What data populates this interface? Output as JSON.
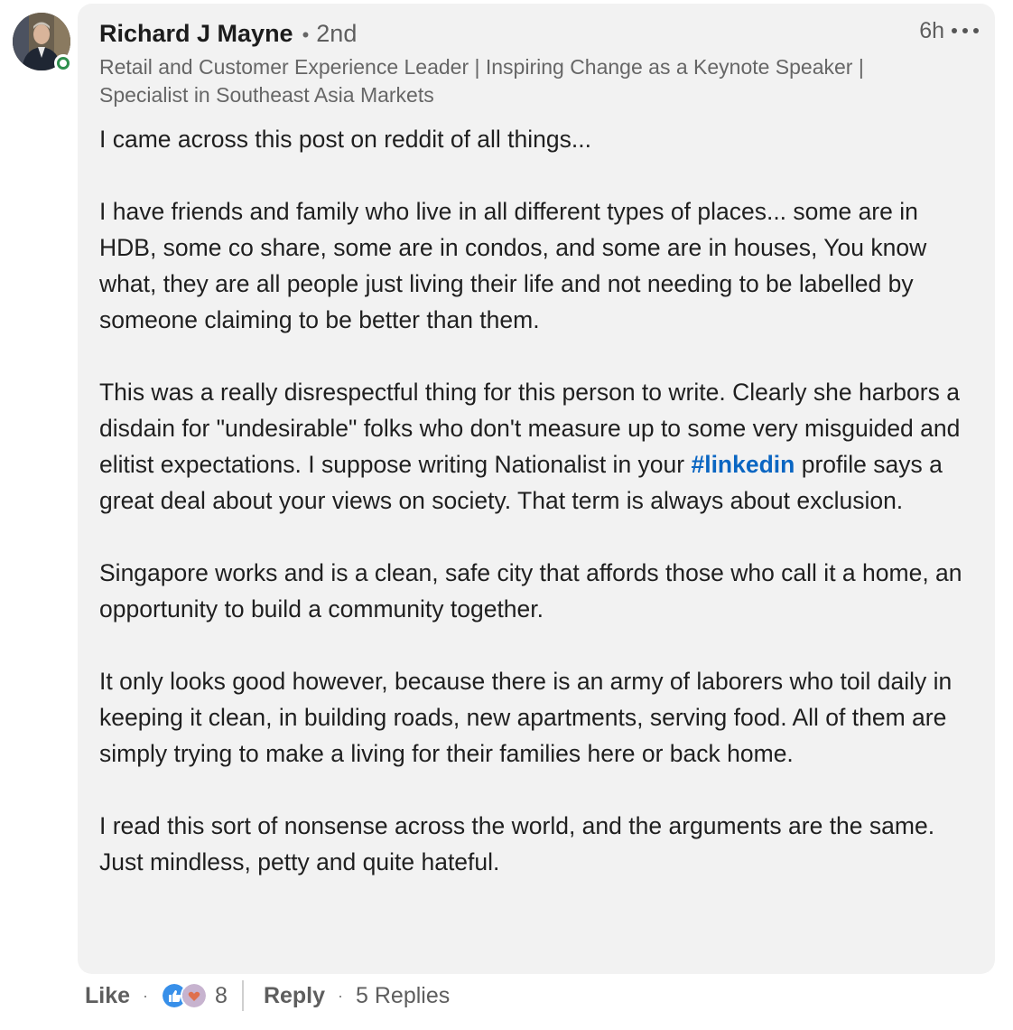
{
  "comment": {
    "author": {
      "name": "Richard J Mayne",
      "separator": "•",
      "degree": "2nd",
      "headline": "Retail and Customer Experience Leader | Inspiring Change as a Keynote Speaker | Specialist in Southeast Asia Markets",
      "online_status_color": "#2f8f4e"
    },
    "timestamp": "6h",
    "more_icon": "ellipsis-icon",
    "body": {
      "p1": "I came across this post on reddit of all things...",
      "p2": "I have friends and family who live in all different types of places... some are in HDB, some co share, some are in condos, and some are in houses, You know what, they are all people just living their life and not needing to be labelled by someone claiming to be better than them.",
      "p3_before": "This was a really disrespectful thing for this person to write. Clearly she harbors a disdain for \"undesirable\" folks who don't measure up to some very misguided and elitist expectations. I suppose writing Nationalist in your ",
      "p3_hashtag": "#linkedin",
      "p3_after": " profile says a great deal about your views on society. That term is always about exclusion.",
      "p4": "Singapore works and is a clean, safe city that affords those who call it a home, an opportunity to build a community together.",
      "p5": "It only looks good however, because there is an army of laborers who toil daily in keeping it clean, in building roads, new apartments, serving food. All of them are simply trying to make a living for their families here or back home.",
      "p6": "I read this sort of nonsense across the world, and the arguments are the same. Just mindless, petty and quite hateful."
    },
    "hashtag_color": "#0a66c2"
  },
  "actions": {
    "like_label": "Like",
    "dot": "·",
    "reaction_icons": [
      "like-reaction-icon",
      "love-reaction-icon"
    ],
    "reaction_count": "8",
    "reply_label": "Reply",
    "replies_label": "5 Replies"
  }
}
